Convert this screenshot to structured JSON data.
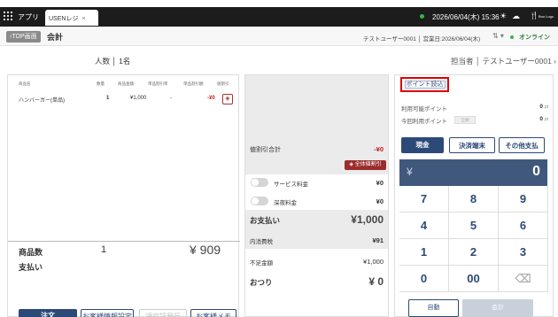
{
  "topbar": {
    "apps": "アプリ",
    "tab": "USENレジ",
    "tab_close": "×",
    "datetime": "2026/06/04(木) 15:36",
    "user_mark": "Boo Logo"
  },
  "header": {
    "back": "TOP画面",
    "title": "会計",
    "store_info": "テストユーザー0001 │ 営業日:2026/06/04(木)",
    "online": "オンライン"
  },
  "info": {
    "people_label": "人数",
    "people_value": "1名",
    "staff_label": "担当者",
    "staff_value": "テストユーザー0001"
  },
  "table": {
    "columns": [
      "商品名",
      "数量",
      "商品金額",
      "単品割引率",
      "単品割引額",
      "値割引"
    ],
    "rows": [
      {
        "name": "ハンバーガー(単品)",
        "qty": "1",
        "price": "¥1,000",
        "rate": "-",
        "amount": "-¥0"
      }
    ]
  },
  "summary": {
    "count_label": "商品数",
    "count_value": "1",
    "total_value": "¥ 909",
    "pay_label": "支払い"
  },
  "bottom_buttons": {
    "order": "注文",
    "customer": "お客様情報設定",
    "receipt": "領収証発行",
    "memo": "お客様メモ"
  },
  "middle": {
    "discount_total_label": "値割引合計",
    "discount_total_value": "-¥0",
    "all_discount": "全体値割引",
    "service_label": "サービス料金",
    "service_value": "¥0",
    "late_label": "深夜料金",
    "late_value": "¥0",
    "pay_label": "お支払い",
    "pay_value": "¥1,000",
    "tax_label": "内消費税",
    "tax_value": "¥91",
    "shortage_label": "不足金額",
    "shortage_value": "¥1,000",
    "change_label": "おつり",
    "change_value": "¥ 0"
  },
  "right": {
    "point_button": "ポイント読込",
    "available_label": "利用可能ポイント",
    "available_value": "0",
    "unit": "pt",
    "use_label": "今回利用ポイント",
    "use_field": "全額",
    "use_value": "0",
    "cash": "現金",
    "terminal": "決済端末",
    "other": "その他支払",
    "display_yen": "¥",
    "display_value": "0",
    "keys": [
      "7",
      "8",
      "9",
      "4",
      "5",
      "6",
      "1",
      "2",
      "3",
      "0",
      "00",
      "⌫"
    ],
    "auto": "自動",
    "checkout": "会計"
  },
  "colors": {
    "accent": "#2c4a78",
    "highlight": "#e00000",
    "discount": "#9b2c2c",
    "online": "#39b54a"
  }
}
